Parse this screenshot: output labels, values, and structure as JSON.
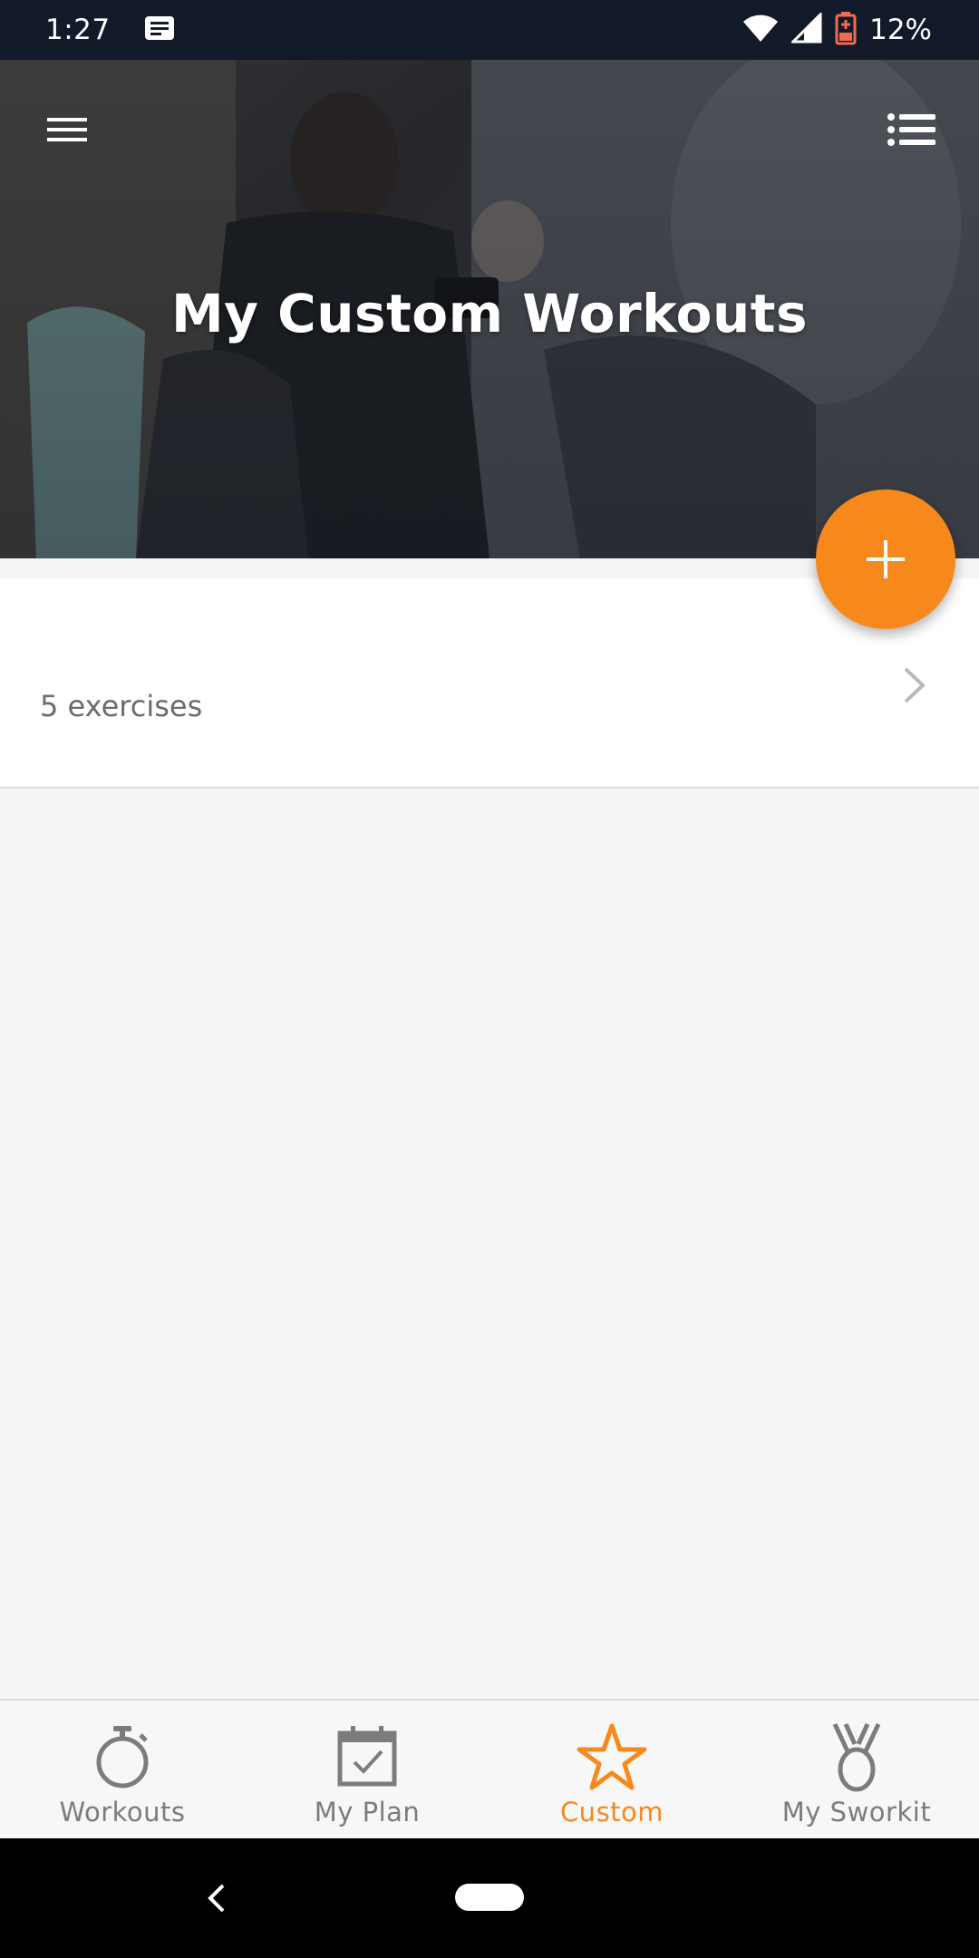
{
  "status_bar": {
    "time": "1:27",
    "battery_percent": "12%",
    "icons": [
      "message-icon",
      "wifi-icon",
      "signal-icon",
      "battery-icon"
    ]
  },
  "header": {
    "title": "My Custom Workouts",
    "menu_icon": "hamburger-menu-icon",
    "list_icon": "list-view-icon"
  },
  "fab": {
    "icon": "plus-icon",
    "color": "#f7891c"
  },
  "workouts": [
    {
      "name": "",
      "exercise_count": "5 exercises"
    }
  ],
  "bottom_nav": {
    "items": [
      {
        "label": "Workouts",
        "icon": "stopwatch-icon",
        "active": false
      },
      {
        "label": "My Plan",
        "icon": "calendar-check-icon",
        "active": false
      },
      {
        "label": "Custom",
        "icon": "star-icon",
        "active": true
      },
      {
        "label": "My Sworkit",
        "icon": "medal-icon",
        "active": false
      }
    ]
  },
  "colors": {
    "accent": "#f7891c",
    "status_bar": "#121a2a",
    "nav_inactive": "#7c7c7c",
    "battery_low": "#f26b4f"
  }
}
